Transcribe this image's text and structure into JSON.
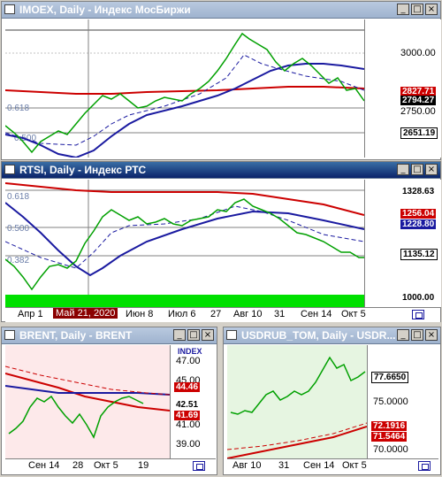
{
  "windows": {
    "imoex": {
      "title": "IMOEX, Daily - Индекс МосБиржи",
      "axis_ticks": [
        "3000.00",
        "2750.00"
      ],
      "price_tags": [
        {
          "label": "2827.71",
          "color": "#cc0000"
        },
        {
          "label": "2794.27",
          "color": "#000000"
        },
        {
          "label": "2651.19",
          "color": "#000000"
        }
      ],
      "fib_labels": [
        "0.618",
        "0.500"
      ]
    },
    "rtsi": {
      "title": "RTSI, Daily - Индекс РТС",
      "price_tags": [
        {
          "label": "1328.63",
          "color": "#000000"
        },
        {
          "label": "1256.04",
          "color": "#cc0000"
        },
        {
          "label": "1228.80",
          "color": "#1a1aa0"
        },
        {
          "label": "1135.12",
          "color": "#000000"
        },
        {
          "label": "1000.00",
          "color": "#000000"
        }
      ],
      "fib_labels": [
        "0.618",
        "0.500",
        "0.382"
      ],
      "date_labels": [
        "Апр 1",
        "Май 21, 2020",
        "Июн 8",
        "Июл 6",
        "27",
        "Авг 10",
        "31",
        "Сен 14",
        "Окт 5"
      ]
    },
    "brent": {
      "title": "BRENT, Daily - BRENT",
      "axis_ticks": [
        "47.00",
        "45.00",
        "41.00",
        "39.00"
      ],
      "index_label": "INDEX",
      "price_tags": [
        {
          "label": "44.46",
          "color": "#cc0000"
        },
        {
          "label": "42.51",
          "color": "#000000"
        },
        {
          "label": "41.69",
          "color": "#cc0000"
        }
      ],
      "date_labels": [
        "Сен 14",
        "28",
        "Окт 5",
        "19"
      ]
    },
    "usdrub": {
      "title": "USDRUB_TOM, Daily - USDR...",
      "axis_ticks": [
        "75.0000",
        "70.0000"
      ],
      "price_tags": [
        {
          "label": "77.6650",
          "color": "#000000"
        },
        {
          "label": "72.1916",
          "color": "#cc0000"
        },
        {
          "label": "71.5464",
          "color": "#cc0000"
        }
      ],
      "date_labels": [
        "Авг 10",
        "31",
        "Сен 14",
        "Окт 5"
      ]
    }
  },
  "colors": {
    "titlebar_active": "#0a246a",
    "titlebar_inactive": "#9fb3cf",
    "candle_up": "#00a000",
    "candle_down": "#cc0000",
    "ma_red": "#cc0000",
    "ma_blue": "#1a1aa0",
    "brent_bg": "#fde9ea",
    "usdrub_bg": "#e6f5e1",
    "volume_green": "#00e000"
  },
  "icons": {
    "chart_icon": "chart-window-icon",
    "minimize": "_",
    "maximize": "□",
    "close": "×"
  }
}
